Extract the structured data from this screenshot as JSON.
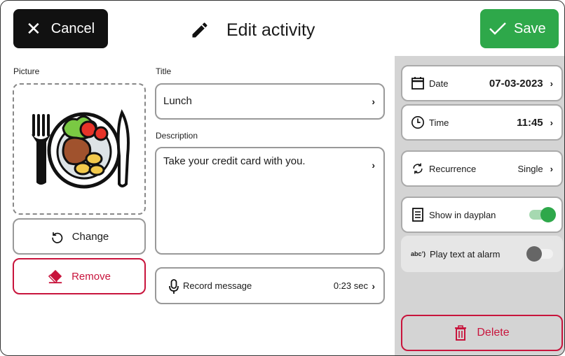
{
  "header": {
    "cancel_label": "Cancel",
    "title": "Edit activity",
    "save_label": "Save"
  },
  "picture": {
    "label": "Picture",
    "image_icon": "plate-with-fork-and-knife-icon",
    "change_label": "Change",
    "remove_label": "Remove"
  },
  "title_field": {
    "label": "Title",
    "value": "Lunch"
  },
  "description_field": {
    "label": "Description",
    "value": "Take your credit card with you."
  },
  "record": {
    "label": "Record message",
    "duration": "0:23 sec"
  },
  "settings": {
    "date": {
      "label": "Date",
      "value": "07-03-2023"
    },
    "time": {
      "label": "Time",
      "value": "11:45"
    },
    "recurrence": {
      "label": "Recurrence",
      "value": "Single"
    },
    "show_in_dayplan": {
      "label": "Show in dayplan",
      "enabled": true
    },
    "play_text": {
      "icon_text": "abc’)",
      "label": "Play text at alarm",
      "enabled": false
    },
    "delete_label": "Delete"
  },
  "colors": {
    "accent_green": "#2ea84a",
    "danger_red": "#c8143c",
    "sidebar_gray": "#d4d4d4"
  }
}
